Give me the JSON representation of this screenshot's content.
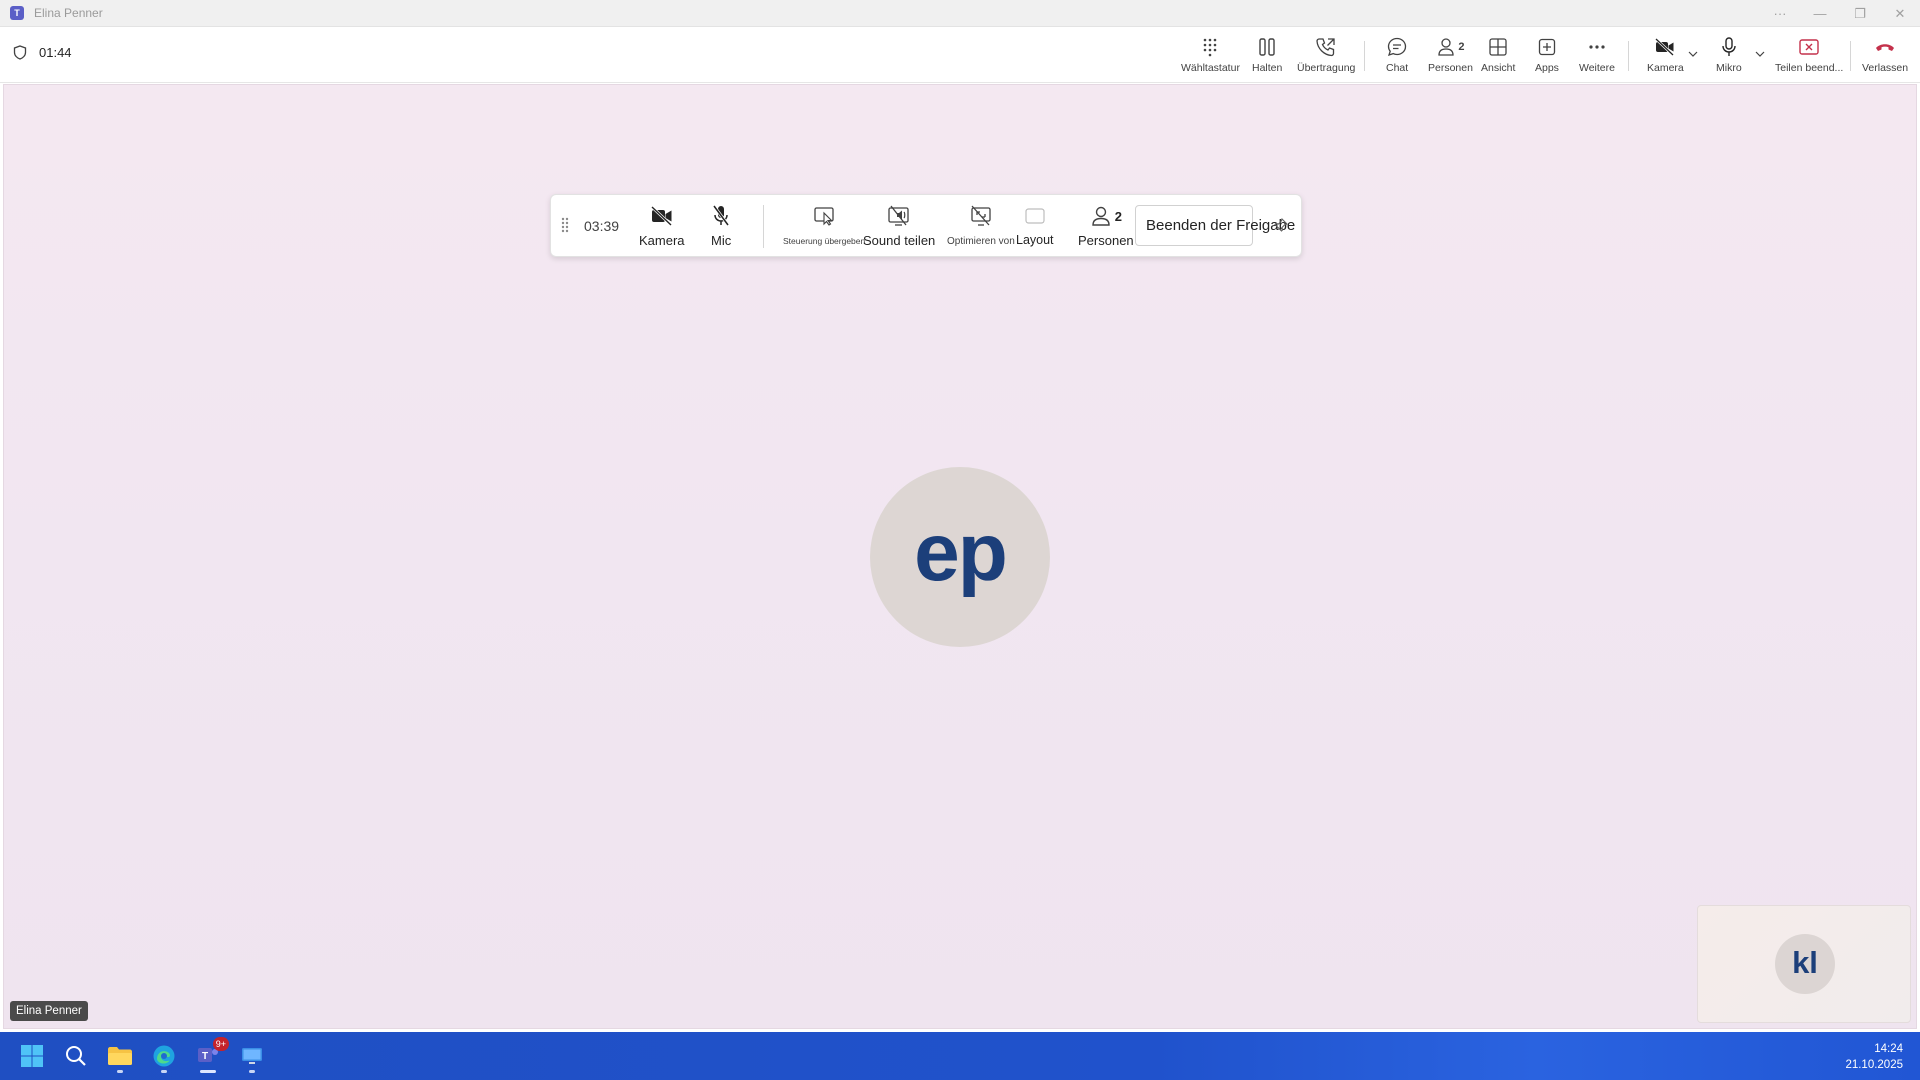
{
  "window": {
    "title": "Elina Penner",
    "controls": {
      "more": "···",
      "minimize": "—",
      "maximize": "❐",
      "close": "✕"
    }
  },
  "meeting": {
    "duration": "01:44",
    "toolbar": {
      "dialpad": "Wähltastatur",
      "hold": "Halten",
      "transfer": "Übertragung",
      "chat": "Chat",
      "people": "Personen",
      "people_count": "2",
      "view": "Ansicht",
      "apps": "Apps",
      "more": "Weitere",
      "camera": "Kamera",
      "mic": "Mikro",
      "stop_sharing": "Teilen beend...",
      "leave": "Verlassen"
    }
  },
  "share_bar": {
    "duration": "03:39",
    "camera": "Kamera",
    "mic": "Mic",
    "give_control": "Steuerung übergeben",
    "share_sound": "Sound teilen",
    "optimize": "Optimieren von",
    "layout": "Layout",
    "people": "Personen",
    "people_count": "2",
    "stop_button": "Beenden der Freigabe"
  },
  "stage": {
    "main_participant_initials": "ep",
    "name_tag": "Elina Penner",
    "self_initials": "kl"
  },
  "taskbar": {
    "teams_badge": "9+",
    "time": "14:24",
    "date": "21.10.2025"
  },
  "colors": {
    "accent": "#5b5fc7",
    "leave_red": "#c4314b",
    "stage_bg": "#f2e7f1",
    "initials_blue": "#1c3f7a",
    "taskbar_blue": "#2052cc"
  }
}
